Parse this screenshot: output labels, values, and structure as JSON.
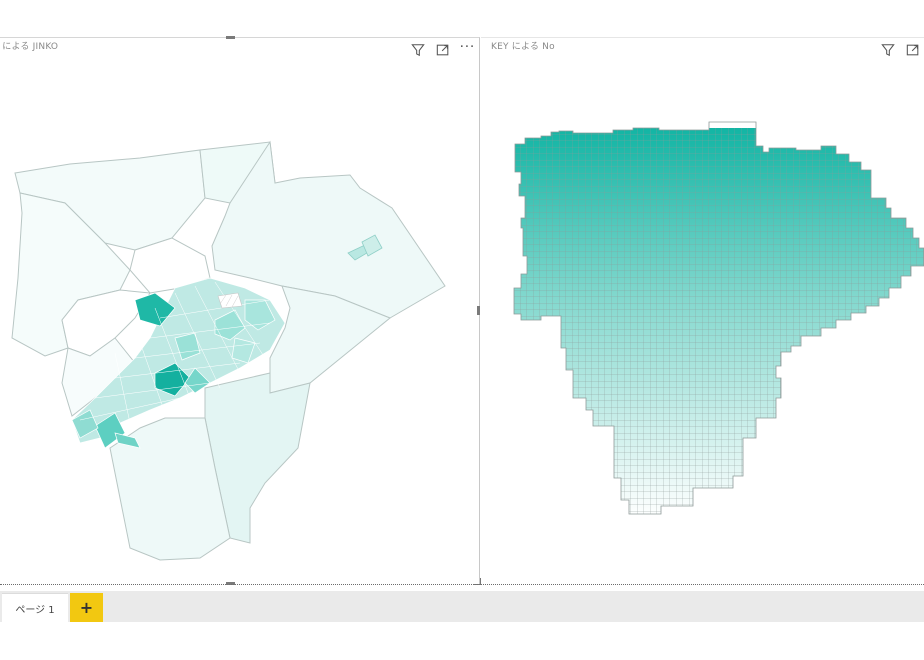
{
  "visuals": {
    "left": {
      "title": "/ による JINKO"
    },
    "right": {
      "title": "KEY による No"
    }
  },
  "icons": {
    "filter": "filter-icon",
    "focus": "focus-mode-icon",
    "more": "more-options-icon",
    "more_glyph": "···"
  },
  "colors": {
    "accent": "#12b5a4",
    "light": "#eaf8f7",
    "page_bar": "#eaeaea",
    "add_button": "#f2c811"
  },
  "pages": {
    "tabs": [
      "ページ 1"
    ],
    "add_label": "+"
  }
}
